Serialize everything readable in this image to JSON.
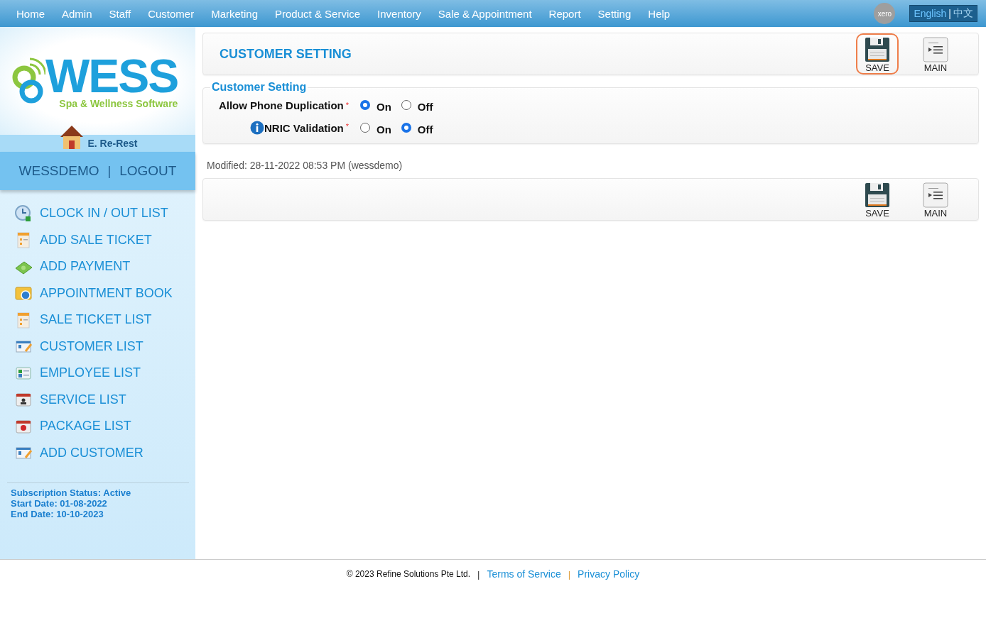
{
  "nav": {
    "items": [
      "Home",
      "Admin",
      "Staff",
      "Customer",
      "Marketing",
      "Product & Service",
      "Inventory",
      "Sale & Appointment",
      "Report",
      "Setting",
      "Help"
    ],
    "xero": "xero",
    "language": {
      "separator": "|",
      "options": [
        {
          "label": "English",
          "selected": true
        },
        {
          "label": "中文",
          "selected": false
        }
      ]
    }
  },
  "sidebar": {
    "logo": {
      "wordmark": "WESS",
      "tagline": "Spa & Wellness Software"
    },
    "outlet": "E. Re-Rest",
    "user": "WESSDEMO",
    "separator": "|",
    "logout": "LOGOUT",
    "items": [
      {
        "label": "CLOCK IN / OUT LIST",
        "kind": "clock"
      },
      {
        "label": "ADD SALE TICKET",
        "kind": "ticket"
      },
      {
        "label": "ADD PAYMENT",
        "kind": "payment"
      },
      {
        "label": "APPOINTMENT BOOK",
        "kind": "calendar"
      },
      {
        "label": "SALE TICKET LIST",
        "kind": "ticket"
      },
      {
        "label": "CUSTOMER LIST",
        "kind": "card"
      },
      {
        "label": "EMPLOYEE LIST",
        "kind": "employee"
      },
      {
        "label": "SERVICE LIST",
        "kind": "service"
      },
      {
        "label": "PACKAGE LIST",
        "kind": "package"
      },
      {
        "label": "ADD CUSTOMER",
        "kind": "card"
      }
    ],
    "subscription": [
      "Subscription Status: Active",
      "Start Date: 01-08-2022",
      "End Date: 10-10-2023"
    ]
  },
  "header": {
    "title": "CUSTOMER SETTING",
    "buttons": [
      {
        "label": "SAVE",
        "kind": "save",
        "highlighted": true
      },
      {
        "label": "MAIN",
        "kind": "main",
        "highlighted": false
      }
    ]
  },
  "section": {
    "legend": "Customer Setting",
    "fields": [
      {
        "label": "Allow Phone Duplication",
        "required": "*",
        "info": false,
        "options": [
          {
            "label": "On",
            "selected": true
          },
          {
            "label": "Off",
            "selected": false
          }
        ]
      },
      {
        "label": "NRIC Validation",
        "required": "*",
        "info": true,
        "options": [
          {
            "label": "On",
            "selected": false
          },
          {
            "label": "Off",
            "selected": true
          }
        ]
      }
    ]
  },
  "modified": "Modified: 28-11-2022 08:53 PM (wessdemo)",
  "footer_toolbar": {
    "buttons": [
      {
        "label": "SAVE",
        "kind": "save",
        "highlighted": false
      },
      {
        "label": "MAIN",
        "kind": "main",
        "highlighted": false
      }
    ]
  },
  "footer": {
    "copyright": "© 2023 Refine Solutions Pte Ltd.",
    "separator_1": "|",
    "terms": "Terms of Service",
    "separator_2": "|",
    "privacy": "Privacy Policy"
  }
}
